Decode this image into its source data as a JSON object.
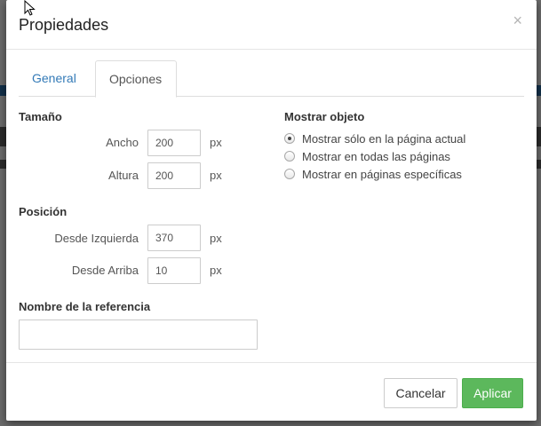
{
  "dialog": {
    "title": "Propiedades",
    "close_glyph": "×"
  },
  "tabs": [
    {
      "label": "General",
      "active": false
    },
    {
      "label": "Opciones",
      "active": true
    }
  ],
  "size": {
    "heading": "Tamaño",
    "width_label": "Ancho",
    "width_value": "200",
    "height_label": "Altura",
    "height_value": "200",
    "unit": "px"
  },
  "position": {
    "heading": "Posición",
    "left_label": "Desde Izquierda",
    "left_value": "370",
    "top_label": "Desde Arriba",
    "top_value": "10",
    "unit": "px"
  },
  "reference": {
    "heading": "Nombre de la referencia",
    "value": ""
  },
  "show_object": {
    "heading": "Mostrar objeto",
    "options": [
      {
        "label": "Mostrar sólo en la página actual",
        "checked": true
      },
      {
        "label": "Mostrar en todas las páginas",
        "checked": false
      },
      {
        "label": "Mostrar en páginas específicas",
        "checked": false
      }
    ]
  },
  "footer": {
    "cancel_label": "Cancelar",
    "apply_label": "Aplicar"
  },
  "colors": {
    "apply": "#5cb85c",
    "tab_link": "#337ab7"
  },
  "icons": {
    "cursor": "mouse-pointer-icon",
    "close": "close-icon"
  }
}
